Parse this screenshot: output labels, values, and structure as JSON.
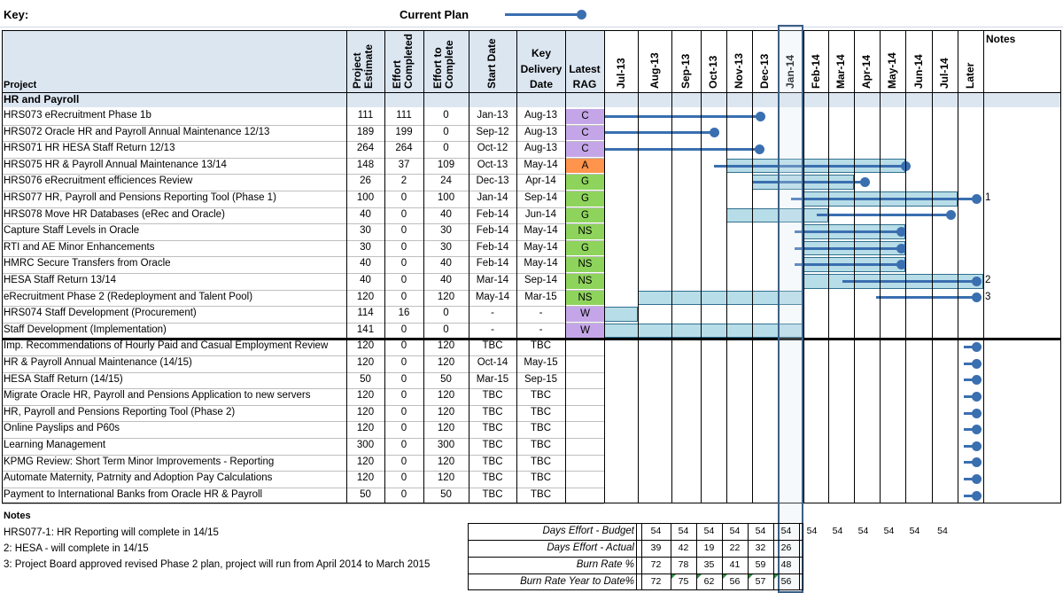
{
  "key": {
    "label": "Key:",
    "current_plan": "Current Plan"
  },
  "headers": {
    "project": "Project",
    "project_estimate": "Project Estimate",
    "effort_completed": "Effort Completed",
    "effort_to_complete": "Effort to Complete",
    "start_date": "Start Date",
    "key_delivery_date_l1": "Key",
    "key_delivery_date_l2": "Delivery",
    "key_delivery_date_l3": "Date",
    "latest_rag_l1": "Latest",
    "latest_rag_l2": "RAG",
    "notes": "Notes",
    "months": [
      "Jul-13",
      "Aug-13",
      "Sep-13",
      "Oct-13",
      "Nov-13",
      "Dec-13",
      "Jan-14",
      "Feb-14",
      "Mar-14",
      "Apr-14",
      "May-14",
      "Jun-14",
      "Jul-14",
      "Later"
    ]
  },
  "section_title": "HR and Payroll",
  "colors": {
    "C": "#c4a6e8",
    "A": "#ff944d",
    "G": "#8ed45c",
    "NS": "#8ed45c",
    "W": "#c4a6e8",
    "bar": "#b7dde8",
    "plan": "#3a6fb0"
  },
  "rows": [
    {
      "name": "HRS073 eRecruitment Phase 1b",
      "est": "111",
      "done": "111",
      "todo": "0",
      "start": "Jan-13",
      "key": "Aug-13",
      "rag": "C"
    },
    {
      "name": "HRS072 Oracle HR and Payroll Annual Maintenance 12/13",
      "est": "189",
      "done": "199",
      "todo": "0",
      "start": "Sep-12",
      "key": "Aug-13",
      "rag": "C"
    },
    {
      "name": "HRS071 HR HESA Staff Return 12/13",
      "est": "264",
      "done": "264",
      "todo": "0",
      "start": "Oct-12",
      "key": "Aug-13",
      "rag": "C"
    },
    {
      "name": "HRS075 HR & Payroll Annual Maintenance 13/14",
      "est": "148",
      "done": "37",
      "todo": "109",
      "start": "Oct-13",
      "key": "May-14",
      "rag": "A"
    },
    {
      "name": "HRS076 eRecruitment efficiences Review",
      "est": "26",
      "done": "2",
      "todo": "24",
      "start": "Dec-13",
      "key": "Apr-14",
      "rag": "G"
    },
    {
      "name": "HRS077 HR, Payroll and Pensions Reporting Tool (Phase 1)",
      "est": "100",
      "done": "0",
      "todo": "100",
      "start": "Jan-14",
      "key": "Sep-14",
      "rag": "G",
      "note": "1"
    },
    {
      "name": "HRS078 Move HR Databases (eRec and Oracle)",
      "est": "40",
      "done": "0",
      "todo": "40",
      "start": "Feb-14",
      "key": "Jun-14",
      "rag": "G"
    },
    {
      "name": "Capture Staff Levels in Oracle",
      "est": "30",
      "done": "0",
      "todo": "30",
      "start": "Feb-14",
      "key": "May-14",
      "rag": "NS"
    },
    {
      "name": "RTI and AE Minor Enhancements",
      "est": "30",
      "done": "0",
      "todo": "30",
      "start": "Feb-14",
      "key": "May-14",
      "rag": "G"
    },
    {
      "name": "HMRC Secure Transfers from Oracle",
      "est": "40",
      "done": "0",
      "todo": "40",
      "start": "Feb-14",
      "key": "May-14",
      "rag": "NS"
    },
    {
      "name": "HESA Staff Return 13/14",
      "est": "40",
      "done": "0",
      "todo": "40",
      "start": "Mar-14",
      "key": "Sep-14",
      "rag": "NS",
      "note": "2"
    },
    {
      "name": "eRecruitment Phase 2 (Redeployment and Talent Pool)",
      "est": "120",
      "done": "0",
      "todo": "120",
      "start": "May-14",
      "key": "Mar-15",
      "rag": "NS",
      "note": "3"
    },
    {
      "name": "HRS074 Staff Development (Procurement)",
      "est": "114",
      "done": "16",
      "todo": "0",
      "start": "-",
      "key": "-",
      "rag": "W"
    },
    {
      "name": "Staff Development (Implementation)",
      "est": "141",
      "done": "0",
      "todo": "0",
      "start": "-",
      "key": "-",
      "rag": "W"
    },
    {
      "name": "Imp. Recommendations of Hourly Paid and Casual Employment Review",
      "est": "120",
      "done": "0",
      "todo": "120",
      "start": "TBC",
      "key": "TBC",
      "rag": ""
    },
    {
      "name": "HR & Payroll Annual Maintenance (14/15)",
      "est": "120",
      "done": "0",
      "todo": "120",
      "start": "Oct-14",
      "key": "May-15",
      "rag": ""
    },
    {
      "name": "HESA Staff Return (14/15)",
      "est": "50",
      "done": "0",
      "todo": "50",
      "start": "Mar-15",
      "key": "Sep-15",
      "rag": ""
    },
    {
      "name": "Migrate Oracle HR, Payroll and Pensions Application to new servers",
      "est": "120",
      "done": "0",
      "todo": "120",
      "start": "TBC",
      "key": "TBC",
      "rag": ""
    },
    {
      "name": "HR, Payroll and Pensions Reporting Tool (Phase 2)",
      "est": "120",
      "done": "0",
      "todo": "120",
      "start": "TBC",
      "key": "TBC",
      "rag": ""
    },
    {
      "name": "Online Payslips and P60s",
      "est": "120",
      "done": "0",
      "todo": "120",
      "start": "TBC",
      "key": "TBC",
      "rag": ""
    },
    {
      "name": "Learning Management",
      "est": "300",
      "done": "0",
      "todo": "300",
      "start": "TBC",
      "key": "TBC",
      "rag": ""
    },
    {
      "name": "KPMG Review: Short Term Minor Improvements - Reporting",
      "est": "120",
      "done": "0",
      "todo": "120",
      "start": "TBC",
      "key": "TBC",
      "rag": ""
    },
    {
      "name": "Automate Maternity, Patrnity and Adoption Pay Calculations",
      "est": "120",
      "done": "0",
      "todo": "120",
      "start": "TBC",
      "key": "TBC",
      "rag": ""
    },
    {
      "name": "Payment to International Banks from Oracle HR & Payroll",
      "est": "50",
      "done": "0",
      "todo": "50",
      "start": "TBC",
      "key": "TBC",
      "rag": ""
    }
  ],
  "notes": {
    "title": "Notes",
    "lines": [
      "HRS077-1: HR Reporting will complete in 14/15",
      "2: HESA - will complete in 14/15",
      "3: Project Board approved revised Phase 2 plan, project will run from April 2014 to March 2015"
    ]
  },
  "summary": [
    {
      "label": "Days Effort - Budget",
      "values": [
        "54",
        "54",
        "54",
        "54",
        "54",
        "54",
        "54",
        "54",
        "54",
        "54",
        "54",
        "54"
      ]
    },
    {
      "label": "Days Effort - Actual",
      "values": [
        "39",
        "42",
        "19",
        "22",
        "32",
        "26",
        "",
        "",
        "",
        "",
        "",
        ""
      ]
    },
    {
      "label": "Burn Rate %",
      "values": [
        "72",
        "78",
        "35",
        "41",
        "59",
        "48",
        "",
        "",
        "",
        "",
        "",
        ""
      ]
    },
    {
      "label": "Burn Rate Year to Date%",
      "values": [
        "72",
        "75",
        "62",
        "56",
        "57",
        "56",
        "",
        "",
        "",
        "",
        "",
        ""
      ]
    }
  ]
}
